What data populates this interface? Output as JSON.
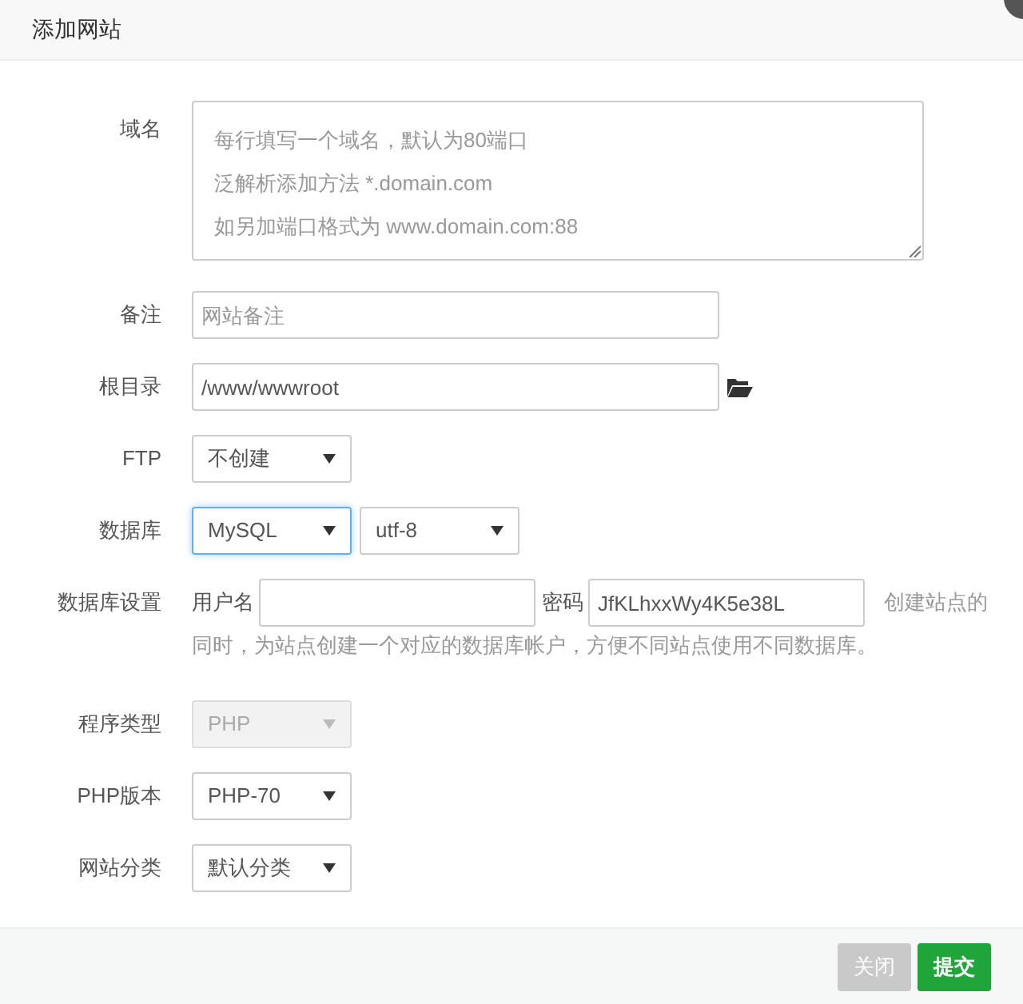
{
  "window": {
    "title": "添加网站"
  },
  "rows": [
    {
      "kind": "textarea",
      "label": "域名",
      "placeholder_lines": [
        "每行填写一个域名，默认为80端口",
        "泛解析添加方法 *.domain.com",
        "如另加端口格式为 www.domain.com:88"
      ]
    },
    {
      "kind": "text",
      "label": "备注",
      "placeholder": "网站备注"
    },
    {
      "kind": "path",
      "label": "根目录",
      "value": "/www/wwwroot"
    },
    {
      "kind": "select",
      "label": "FTP",
      "selects": [
        {
          "value": "不创建",
          "focused": false,
          "disabled": false
        }
      ]
    },
    {
      "kind": "select",
      "label": "数据库",
      "selects": [
        {
          "value": "MySQL",
          "focused": true,
          "disabled": false
        },
        {
          "value": "utf-8",
          "focused": false,
          "disabled": false
        }
      ]
    },
    {
      "kind": "dbsettings",
      "label": "数据库设置",
      "user_label": "用户名",
      "user_value": "",
      "password_label": "密码",
      "password_value": "JfKLhxxWy4K5e38L",
      "help_lines": [
        "创建站点的",
        "同时，为站点创建一个对应的数据库帐户，方便不同站点使用不同数据库。"
      ]
    },
    {
      "kind": "select",
      "label": "程序类型",
      "selects": [
        {
          "value": "PHP",
          "focused": false,
          "disabled": true
        }
      ]
    },
    {
      "kind": "select",
      "label": "PHP版本",
      "selects": [
        {
          "value": "PHP-70",
          "focused": false,
          "disabled": false
        }
      ]
    },
    {
      "kind": "select",
      "label": "网站分类",
      "selects": [
        {
          "value": "默认分类",
          "focused": false,
          "disabled": false
        }
      ]
    }
  ],
  "buttons": [
    {
      "label": "关闭",
      "kind": "secondary"
    },
    {
      "label": "提交",
      "kind": "primary"
    }
  ]
}
